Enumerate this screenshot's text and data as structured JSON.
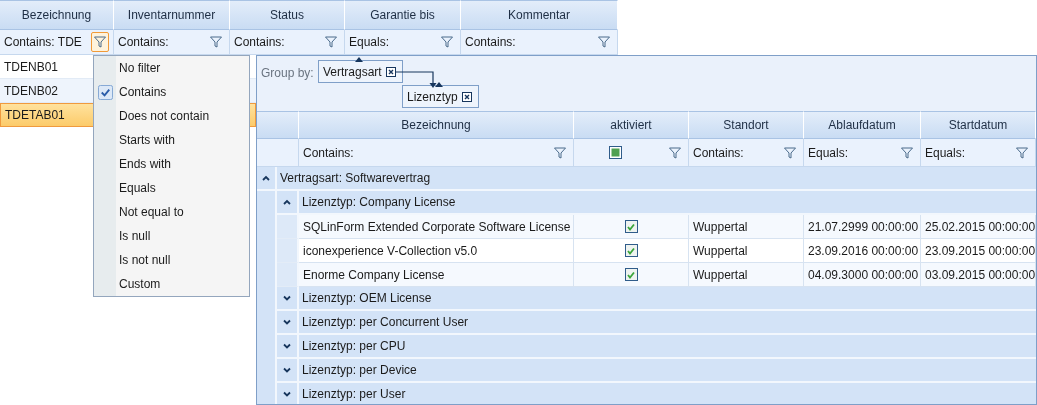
{
  "back_grid": {
    "columns": [
      "Bezeichnung",
      "Inventarnummer",
      "Status",
      "Garantie bis",
      "Kommentar"
    ],
    "filters": [
      {
        "text": "Contains: TDE",
        "active": true
      },
      {
        "text": "Contains:",
        "active": false
      },
      {
        "text": "Contains:",
        "active": false
      },
      {
        "text": "Equals:",
        "active": false
      },
      {
        "text": "Contains:",
        "active": false
      }
    ],
    "rows": [
      {
        "bezeichnung": "TDENB01",
        "selected": false
      },
      {
        "bezeichnung": "TDENB02",
        "selected": false
      },
      {
        "bezeichnung": "TDETAB01",
        "selected": true
      }
    ]
  },
  "filter_menu": {
    "items": [
      {
        "label": "No filter",
        "checked": false
      },
      {
        "label": "Contains",
        "checked": true
      },
      {
        "label": "Does not contain",
        "checked": false
      },
      {
        "label": "Starts with",
        "checked": false
      },
      {
        "label": "Ends with",
        "checked": false
      },
      {
        "label": "Equals",
        "checked": false
      },
      {
        "label": "Not equal to",
        "checked": false
      },
      {
        "label": "Is null",
        "checked": false
      },
      {
        "label": "Is not null",
        "checked": false
      },
      {
        "label": "Custom",
        "checked": false
      }
    ]
  },
  "front_grid": {
    "group_by_label": "Group by:",
    "group_by": [
      {
        "label": "Vertragsart"
      },
      {
        "label": "Lizenztyp"
      }
    ],
    "columns": [
      "Bezeichnung",
      "aktiviert",
      "Standort",
      "Ablaufdatum",
      "Startdatum"
    ],
    "filters": [
      {
        "kind": "text",
        "text": "Contains:"
      },
      {
        "kind": "checkbox",
        "indeterminate": true
      },
      {
        "kind": "text",
        "text": "Contains:"
      },
      {
        "kind": "text",
        "text": "Equals:"
      },
      {
        "kind": "text",
        "text": "Equals:"
      }
    ],
    "groups": [
      {
        "label": "Vertragsart: Softwarevertrag",
        "expanded": true,
        "children": [
          {
            "label": "Lizenztyp: Company License",
            "expanded": true,
            "rows": [
              {
                "bezeichnung": "SQLinForm Extended Corporate Software License",
                "aktiviert": true,
                "standort": "Wuppertal",
                "ablaufdatum": "21.07.2999 00:00:00",
                "startdatum": "25.02.2015 00:00:00"
              },
              {
                "bezeichnung": "iconexperience V-Collection v5.0",
                "aktiviert": true,
                "standort": "Wuppertal",
                "ablaufdatum": "23.09.2016 00:00:00",
                "startdatum": "23.09.2015 00:00:00"
              },
              {
                "bezeichnung": "Enorme Company License",
                "aktiviert": true,
                "standort": "Wuppertal",
                "ablaufdatum": "04.09.3000 00:00:00",
                "startdatum": "03.09.2015 00:00:00"
              }
            ]
          },
          {
            "label": "Lizenztyp: OEM License",
            "expanded": false
          },
          {
            "label": "Lizenztyp: per Concurrent User",
            "expanded": false
          },
          {
            "label": "Lizenztyp: per CPU",
            "expanded": false
          },
          {
            "label": "Lizenztyp: per Device",
            "expanded": false
          },
          {
            "label": "Lizenztyp: per User",
            "expanded": false
          }
        ]
      }
    ]
  }
}
